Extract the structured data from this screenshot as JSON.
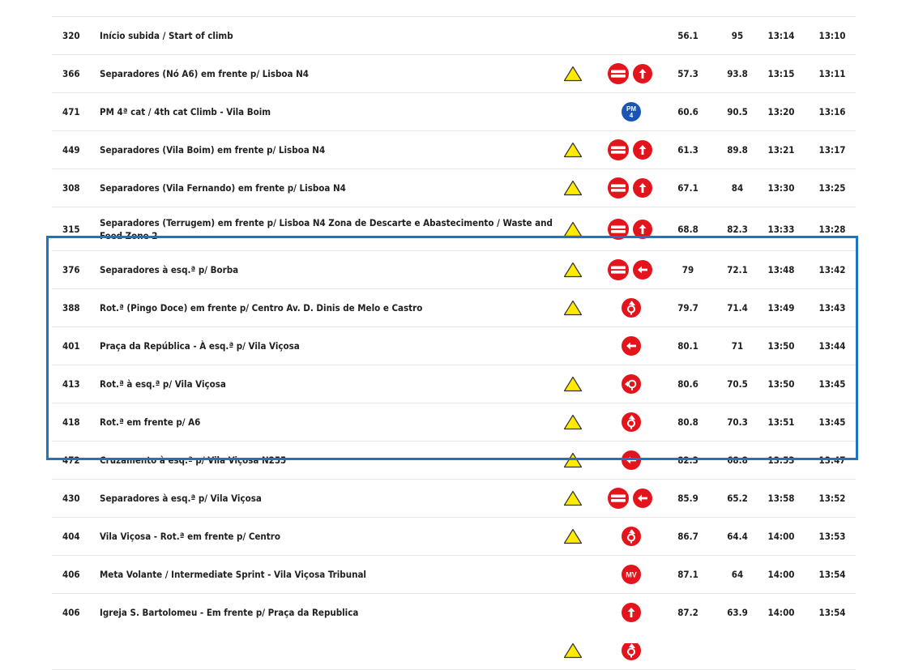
{
  "colors": {
    "accent_red": "#e3141c",
    "warning_yellow": "#ffea00",
    "pm_blue": "#1b55b4",
    "highlight_blue": "#1f73c3"
  },
  "rows": [
    {
      "id": "320",
      "desc": "Início subida / Start of climb",
      "warn": false,
      "icons": [],
      "km": "56.1",
      "rem": "95",
      "t1": "13:14",
      "t2": "13:10"
    },
    {
      "id": "366",
      "desc": "Separadores (Nó A6) em frente p/ Lisboa N4",
      "warn": true,
      "icons": [
        "separator-icon",
        "arrow-up-icon"
      ],
      "km": "57.3",
      "rem": "93.8",
      "t1": "13:15",
      "t2": "13:11"
    },
    {
      "id": "471",
      "desc": "PM 4ª cat / 4th cat Climb - Vila Boim",
      "warn": false,
      "icons": [
        "pm4-badge"
      ],
      "km": "60.6",
      "rem": "90.5",
      "t1": "13:20",
      "t2": "13:16"
    },
    {
      "id": "449",
      "desc": "Separadores (Vila Boim) em frente p/ Lisboa N4",
      "warn": true,
      "icons": [
        "separator-icon",
        "arrow-up-icon"
      ],
      "km": "61.3",
      "rem": "89.8",
      "t1": "13:21",
      "t2": "13:17"
    },
    {
      "id": "308",
      "desc": "Separadores (Vila Fernando) em frente p/ Lisboa N4",
      "warn": true,
      "icons": [
        "separator-icon",
        "arrow-up-icon"
      ],
      "km": "67.1",
      "rem": "84",
      "t1": "13:30",
      "t2": "13:25"
    },
    {
      "id": "315",
      "desc": "Separadores (Terrugem) em frente p/ Lisboa N4 Zona de Descarte e Abastecimento / Waste and Feed Zone 2",
      "warn": true,
      "icons": [
        "separator-icon",
        "arrow-up-icon"
      ],
      "km": "68.8",
      "rem": "82.3",
      "t1": "13:33",
      "t2": "13:28",
      "tall": true
    },
    {
      "id": "376",
      "desc": "Separadores à esq.ª p/ Borba",
      "warn": true,
      "icons": [
        "separator-icon",
        "arrow-left-icon"
      ],
      "km": "79",
      "rem": "72.1",
      "t1": "13:48",
      "t2": "13:42"
    },
    {
      "id": "388",
      "desc": "Rot.ª (Pingo Doce) em frente p/ Centro Av. D. Dinis de Melo e Castro",
      "warn": true,
      "icons": [
        "roundabout-straight-icon"
      ],
      "km": "79.7",
      "rem": "71.4",
      "t1": "13:49",
      "t2": "13:43"
    },
    {
      "id": "401",
      "desc": "Praça da República - À esq.ª p/ Vila Viçosa",
      "warn": false,
      "icons": [
        "arrow-left-icon"
      ],
      "km": "80.1",
      "rem": "71",
      "t1": "13:50",
      "t2": "13:44"
    },
    {
      "id": "413",
      "desc": "Rot.ª à esq.ª p/ Vila Viçosa",
      "warn": true,
      "icons": [
        "roundabout-left-icon"
      ],
      "km": "80.6",
      "rem": "70.5",
      "t1": "13:50",
      "t2": "13:45"
    },
    {
      "id": "418",
      "desc": "Rot.ª em frente p/ A6",
      "warn": true,
      "icons": [
        "roundabout-straight-icon"
      ],
      "km": "80.8",
      "rem": "70.3",
      "t1": "13:51",
      "t2": "13:45"
    },
    {
      "id": "472",
      "desc": "Cruzamento à esq.ª p/ Vila Viçosa N255",
      "warn": true,
      "icons": [
        "arrow-left-icon"
      ],
      "km": "82.3",
      "rem": "68.8",
      "t1": "13:53",
      "t2": "13:47"
    },
    {
      "id": "430",
      "desc": "Separadores à esq.ª p/ Vila Viçosa",
      "warn": true,
      "icons": [
        "separator-icon",
        "arrow-left-icon"
      ],
      "km": "85.9",
      "rem": "65.2",
      "t1": "13:58",
      "t2": "13:52"
    },
    {
      "id": "404",
      "desc": "Vila Viçosa - Rot.ª em frente p/ Centro",
      "warn": true,
      "icons": [
        "roundabout-straight-icon"
      ],
      "km": "86.7",
      "rem": "64.4",
      "t1": "14:00",
      "t2": "13:53"
    },
    {
      "id": "406",
      "desc": "Meta Volante / Intermediate Sprint - Vila Viçosa Tribunal",
      "warn": false,
      "icons": [
        "mv-badge"
      ],
      "km": "87.1",
      "rem": "64",
      "t1": "14:00",
      "t2": "13:54"
    },
    {
      "id": "406",
      "desc": "Igreja S. Bartolomeu - Em frente p/ Praça da Republica",
      "warn": false,
      "icons": [
        "arrow-up-icon"
      ],
      "km": "87.2",
      "rem": "63.9",
      "t1": "14:00",
      "t2": "13:54"
    },
    {
      "id": "",
      "desc": "",
      "warn": true,
      "icons": [
        "roundabout-straight-icon"
      ],
      "km": "",
      "rem": "",
      "t1": "",
      "t2": ""
    }
  ]
}
